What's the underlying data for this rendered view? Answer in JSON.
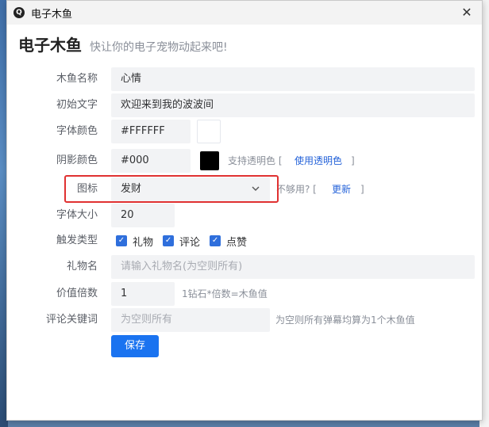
{
  "window": {
    "title": "电子木鱼",
    "close_label": "✕",
    "app_icon_glyph": "Q"
  },
  "header": {
    "app_name": "电子木鱼",
    "slogan": "快让你的电子宠物动起来吧!"
  },
  "form": {
    "name": {
      "label": "木鱼名称",
      "value": "心情"
    },
    "initial_text": {
      "label": "初始文字",
      "value": "欢迎来到我的波波间"
    },
    "font_color": {
      "label": "字体颜色",
      "value": "#FFFFFF",
      "swatch": "#ffffff"
    },
    "shadow_color": {
      "label": "阴影颜色",
      "value": "#000",
      "swatch": "#000000",
      "hint": "支持透明色 [",
      "link": "使用透明色",
      "hint_end": "]"
    },
    "icon": {
      "label": "图标",
      "value": "发财",
      "hint": "不够用? [",
      "link": "更新",
      "hint_end": "]"
    },
    "font_size": {
      "label": "字体大小",
      "value": "20"
    },
    "trigger_type": {
      "label": "触发类型",
      "options": [
        {
          "label": "礼物",
          "checked": true
        },
        {
          "label": "评论",
          "checked": true
        },
        {
          "label": "点赞",
          "checked": true
        }
      ]
    },
    "gift_name": {
      "label": "礼物名",
      "placeholder": "请输入礼物名(为空则所有)"
    },
    "value_multiplier": {
      "label": "价值倍数",
      "value": "1",
      "hint": "1钻石*倍数=木鱼值"
    },
    "comment_keyword": {
      "label": "评论关键词",
      "placeholder": "为空则所有",
      "hint": "为空则所有弹幕均算为1个木鱼值"
    },
    "save_label": "保存"
  },
  "colors": {
    "accent": "#1a73f0",
    "highlight_border": "#e03131",
    "link": "#2563d9"
  }
}
